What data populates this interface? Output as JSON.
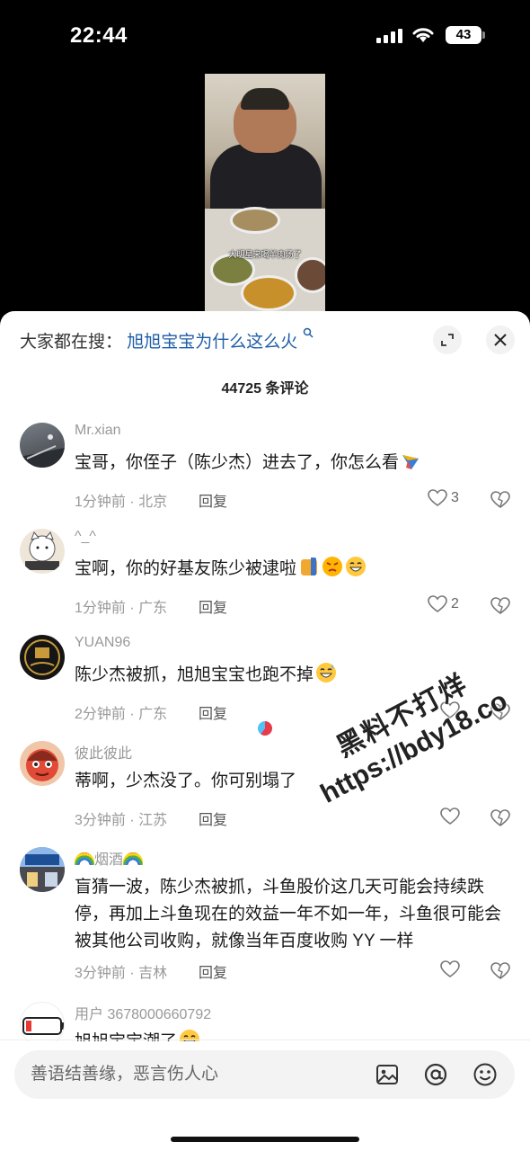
{
  "status_bar": {
    "time": "22:44",
    "battery": "43"
  },
  "video": {
    "caption": "大明星来喝羊肉汤了"
  },
  "sheet": {
    "search_prefix": "大家都在搜：",
    "search_term": "旭旭宝宝为什么这么火",
    "comment_count": "44725 条评论"
  },
  "comments": [
    {
      "username": "Mr.xian",
      "text": "宝哥，你侄子（陈少杰）进去了，你怎么看",
      "meta": "1分钟前 · 北京",
      "reply": "回复",
      "likes": "3",
      "avatar_color": "#555a60"
    },
    {
      "username": "^_^",
      "text": "宝啊，你的好基友陈少被逮啦",
      "meta": "1分钟前 · 广东",
      "reply": "回复",
      "likes": "2",
      "avatar_color": "#d7c9b6"
    },
    {
      "username": "YUAN96",
      "text": "陈少杰被抓，旭旭宝宝也跑不掉",
      "meta": "2分钟前 · 广东",
      "reply": "回复",
      "likes": "",
      "avatar_color": "#1c1c1c"
    },
    {
      "username": "彼此彼此",
      "text": "蒂啊，少杰没了。你可别塌了",
      "meta": "3分钟前 · 江苏",
      "reply": "回复",
      "likes": "",
      "avatar_color": "#c63a2e"
    },
    {
      "username": "烟酒",
      "text": "盲猜一波，陈少杰被抓，斗鱼股价这几天可能会持续跌停，再加上斗鱼现在的效益一年不如一年，斗鱼很可能会被其他公司收购，就像当年百度收购 YY 一样",
      "meta": "3分钟前 · 吉林",
      "reply": "回复",
      "likes": "",
      "avatar_color": "#3a6fb0"
    },
    {
      "username": "用户 3678000660792",
      "text": "旭旭宝宝潮了",
      "meta": "",
      "reply": "",
      "likes": "",
      "avatar_color": "#ffffff"
    }
  ],
  "input_bar": {
    "placeholder": "善语结善缘，恶言伤人心"
  },
  "watermark": {
    "line1": "黑料不打烊",
    "line2": "https://bdy18.co"
  },
  "icons": {
    "expand": "expand-icon",
    "close": "close-icon",
    "like": "heart-icon",
    "dislike": "broken-heart-icon",
    "image": "image-icon",
    "mention": "at-icon",
    "emoji": "emoji-icon"
  }
}
